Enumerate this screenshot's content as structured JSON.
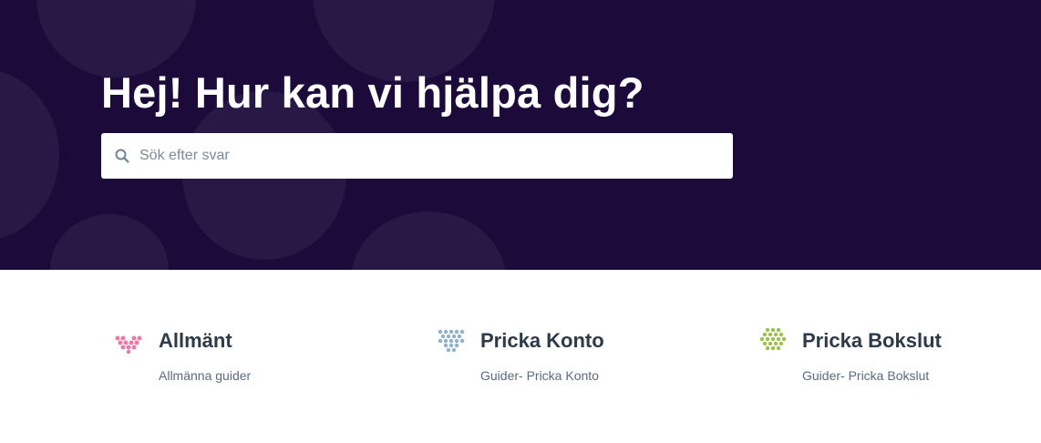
{
  "hero": {
    "title": "Hej! Hur kan vi hjälpa dig?",
    "background_color": "#1b0a3a"
  },
  "search": {
    "placeholder": "Sök efter svar",
    "value": "",
    "icon": "search-icon"
  },
  "categories": [
    {
      "title": "Allmänt",
      "description": "Allmänna guider",
      "icon": "heart-dots-icon",
      "color": "#e879a8"
    },
    {
      "title": "Pricka Konto",
      "description": "Guider- Pricka Konto",
      "icon": "dots-triangle-icon",
      "color": "#8fb2cc"
    },
    {
      "title": "Pricka Bokslut",
      "description": "Guider- Pricka Bokslut",
      "icon": "dots-triangle-icon",
      "color": "#9cc14a"
    }
  ]
}
